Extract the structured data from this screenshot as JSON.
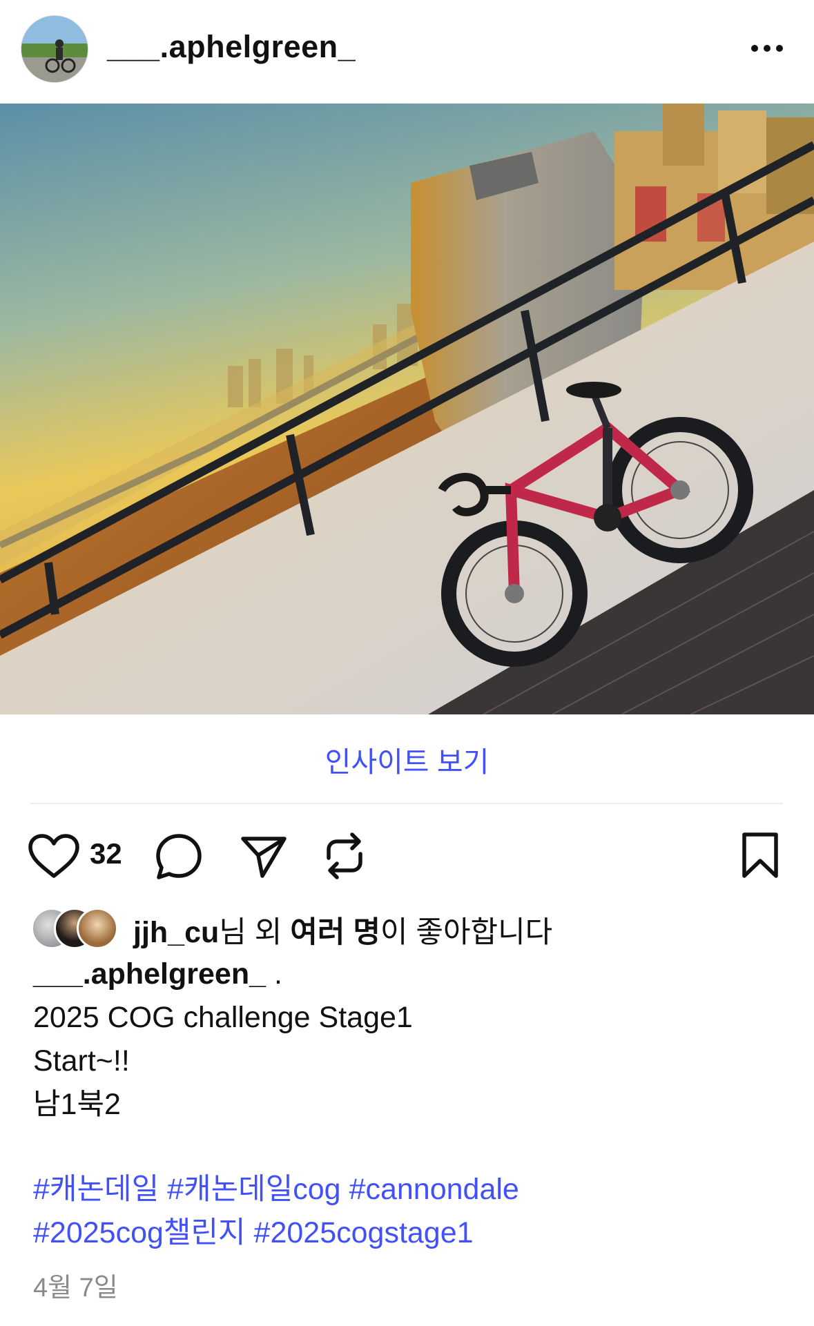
{
  "header": {
    "username": "___.aphelgreen_",
    "more_icon": "more-horizontal-icon"
  },
  "post": {
    "insights_label": "인사이트 보기",
    "like_count": "32",
    "likes_text": {
      "user": "jjh_cu",
      "part1": "님 외 ",
      "bold": "여러 명",
      "part2": "이 좋아합니다"
    },
    "caption": {
      "username": "___.aphelgreen_",
      "after_username": " .",
      "lines": [
        "2025 COG challenge Stage1",
        "Start~!!",
        "남1북2"
      ]
    },
    "hashtags": {
      "line1": [
        "#캐논데일",
        "#캐논데일cog",
        "#cannondale"
      ],
      "line2": [
        "#2025cog챌린지",
        "#2025cogstage1"
      ]
    },
    "date": "4월 7일"
  },
  "colors": {
    "link_blue": "#4150f7",
    "date_gray": "#8a8a8a"
  }
}
